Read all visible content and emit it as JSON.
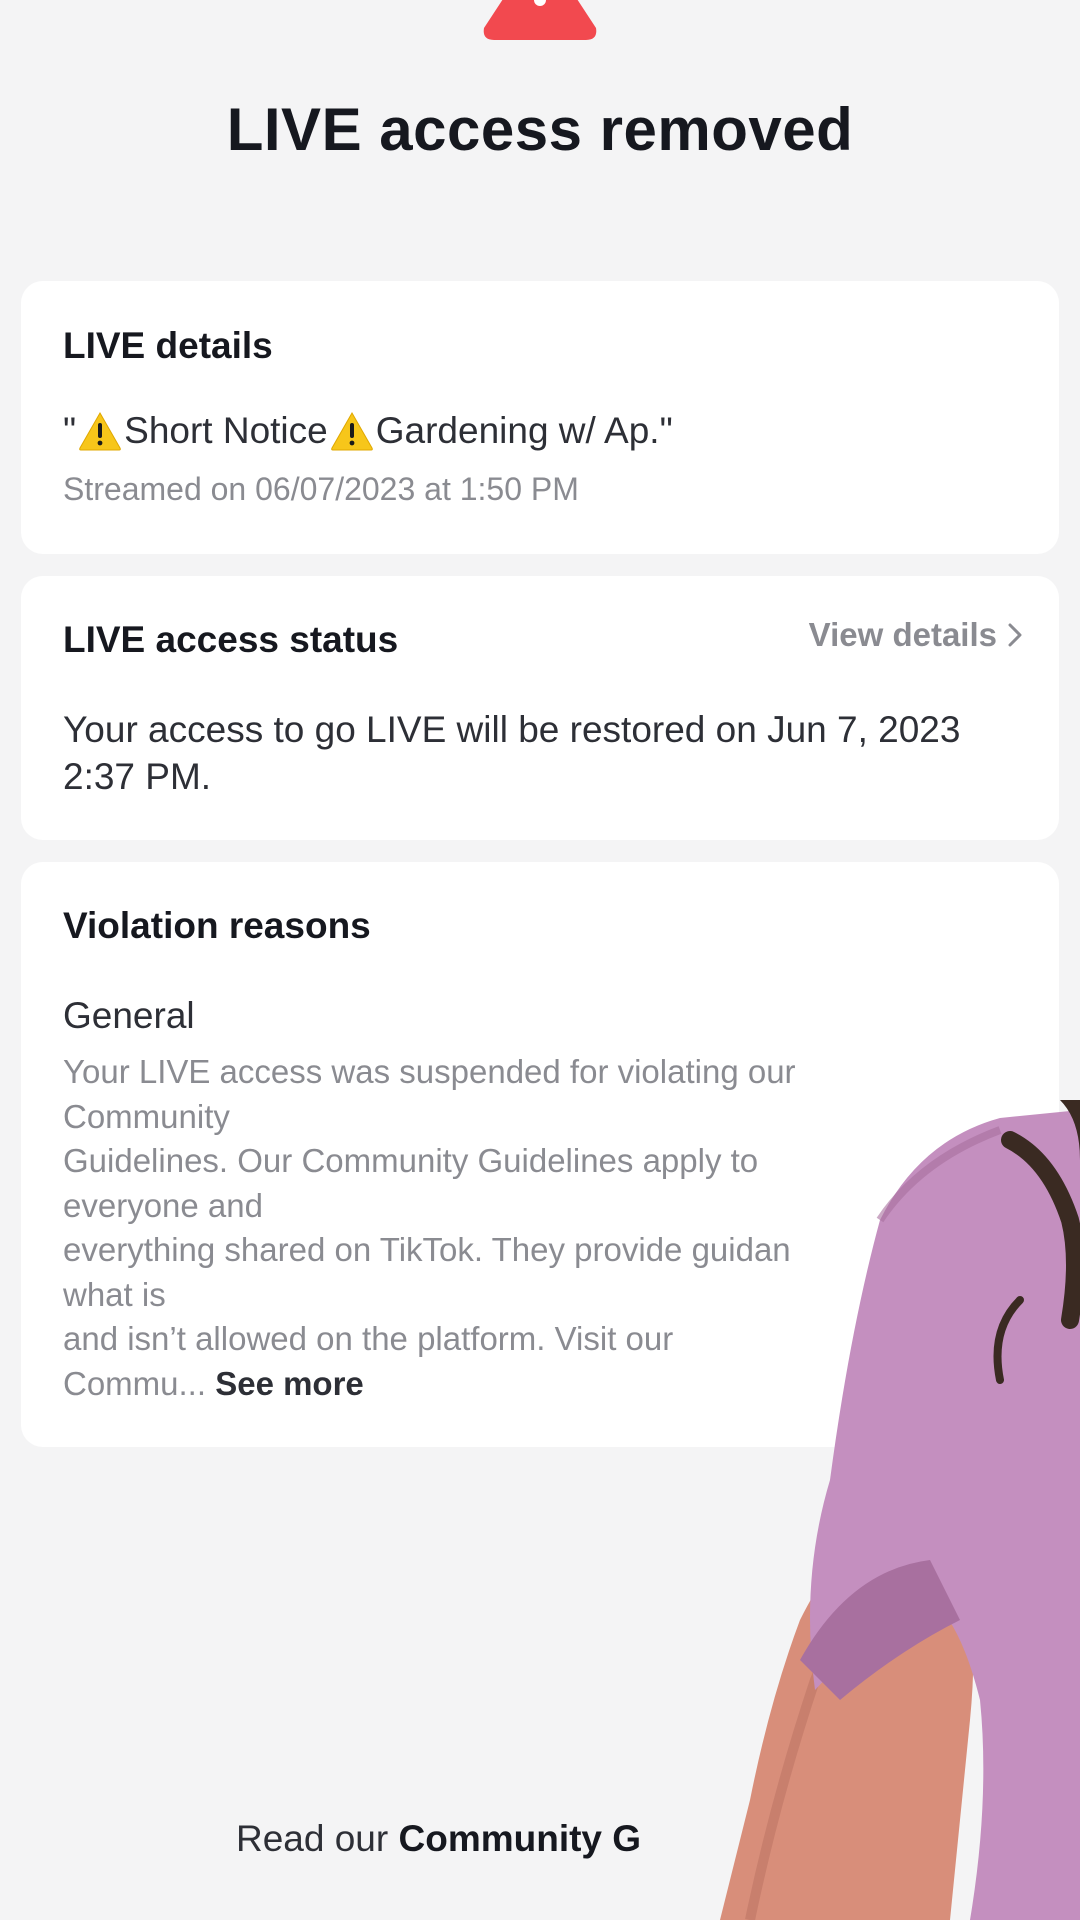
{
  "page": {
    "title": "LIVE access removed",
    "icon": "warning-icon",
    "accent_color": "#f2494f"
  },
  "live_details": {
    "heading": "LIVE details",
    "stream_title_prefix": "\"",
    "stream_title_part1": "Short Notice",
    "stream_title_part2": "Gardening w/ Ap.\"",
    "stream_date": "Streamed on 06/07/2023 at 1:50 PM"
  },
  "access_status": {
    "heading": "LIVE access status",
    "link": "View details",
    "text": "Your access to go LIVE will be restored on Jun 7, 2023 2:37 PM."
  },
  "violation": {
    "heading": "Violation reasons",
    "category": "General",
    "body_lines": [
      "Your LIVE access was suspended for violating our",
      "Community",
      "Guidelines. Our Community Guidelines apply to",
      "everyone and",
      "everything shared on TikTok. They provide guidan",
      "what is",
      "and isn’t allowed on the platform. Visit our"
    ],
    "body_last": "Commu... ",
    "see_more": "See more"
  },
  "footer": {
    "prefix": "Read our ",
    "link": "Community G"
  }
}
